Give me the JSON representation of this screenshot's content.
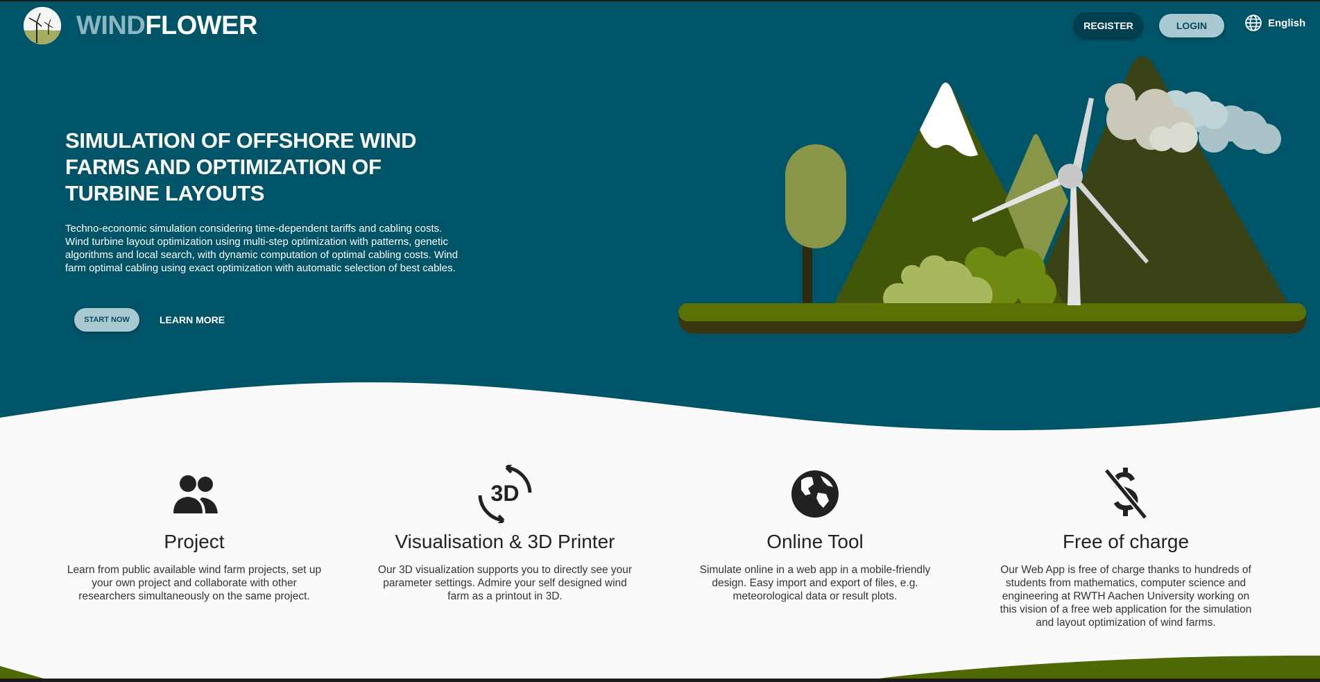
{
  "header": {
    "logo_part1": "WIND",
    "logo_part2": "FLOWER",
    "register_label": "REGISTER",
    "login_label": "LOGIN",
    "language_label": "English"
  },
  "hero": {
    "title": "SIMULATION OF OFFSHORE WIND FARMS AND OPTIMIZATION OF TURBINE LAYOUTS",
    "description": "Techno-economic simulation considering time-dependent tariffs and cabling costs. Wind turbine layout optimization using multi-step optimization with patterns, genetic algorithms and local search, with dynamic computation of optimal cabling costs. Wind farm optimal cabling using exact optimization with automatic selection of best cables.",
    "start_label": "START NOW",
    "learn_label": "LEARN MORE"
  },
  "features": [
    {
      "icon": "people-icon",
      "title": "Project",
      "text": "Learn from public available wind farm projects, set up your own project and collaborate with other researchers simultaneously on the same project."
    },
    {
      "icon": "3d-rotation-icon",
      "icon_text": "3D",
      "title": "Visualisation & 3D Printer",
      "text": "Our 3D visualization supports you to directly see your parameter settings. Admire your self designed wind farm as a printout in 3D."
    },
    {
      "icon": "globe-icon",
      "title": "Online Tool",
      "text": "Simulate online in a web app in a mobile-friendly design. Easy import and export of files, e.g. meteorological data or result plots."
    },
    {
      "icon": "money-off-icon",
      "title": "Free of charge",
      "text": "Our Web App is free of charge thanks to hundreds of students from mathematics, computer science and engineering at RWTH Aachen University working on this vision of a free web application for the simulation and layout optimization of wind farms."
    }
  ],
  "colors": {
    "hero_bg": "#005468",
    "page_bg": "#fafafa",
    "accent_light": "#a8c8d2",
    "grass": "#5a7204"
  }
}
